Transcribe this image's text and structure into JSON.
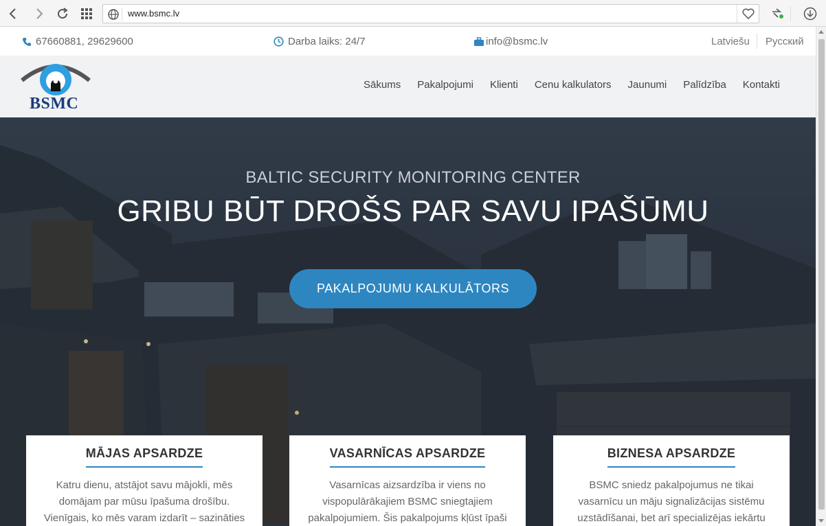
{
  "browser": {
    "url": "www.bsmc.lv"
  },
  "topbar": {
    "phone": "67660881, 29629600",
    "hours": "Darba laiks: 24/7",
    "email": "info@bsmc.lv",
    "languages": [
      "Latviešu",
      "Русский"
    ]
  },
  "header": {
    "logo_text": "BSMC",
    "menu": [
      "Sākums",
      "Pakalpojumi",
      "Klienti",
      "Cenu kalkulators",
      "Jaunumi",
      "Palīdzība",
      "Kontakti"
    ]
  },
  "hero": {
    "subtitle": "BALTIC SECURITY MONITORING CENTER",
    "title": "GRIBU BŪT DROŠS PAR SAVU IPAŠŪMU",
    "button": "PAKALPOJUMU KALKULĀTORS"
  },
  "cards": [
    {
      "title": "MĀJAS APSARDZE",
      "text": "Katru dienu, atstājot savu mājokli, mēs domājam par mūsu īpašuma drošību. Vienīgais, ko mēs varam izdarīt – sazināties ar apsardzes"
    },
    {
      "title": "VASARNĪCAS APSARDZE",
      "text": "Vasarnīcas aizsardzība ir viens no vispopulārākajiem BSMC sniegtajiem pakalpojumiem. Šis pakalpojums kļūst īpaši"
    },
    {
      "title": "BIZNESA APSARDZE",
      "text": "BSMC sniedz pakalpojumus ne tikai vasarnīcu un māju signalizācijas sistēmu uzstādīšanai, bet arī specializējas iekārtu montāžā, lai"
    }
  ],
  "colors": {
    "accent": "#2e86c1",
    "logo_blue": "#1c3a7a",
    "header_bg": "#f0f2f3"
  }
}
